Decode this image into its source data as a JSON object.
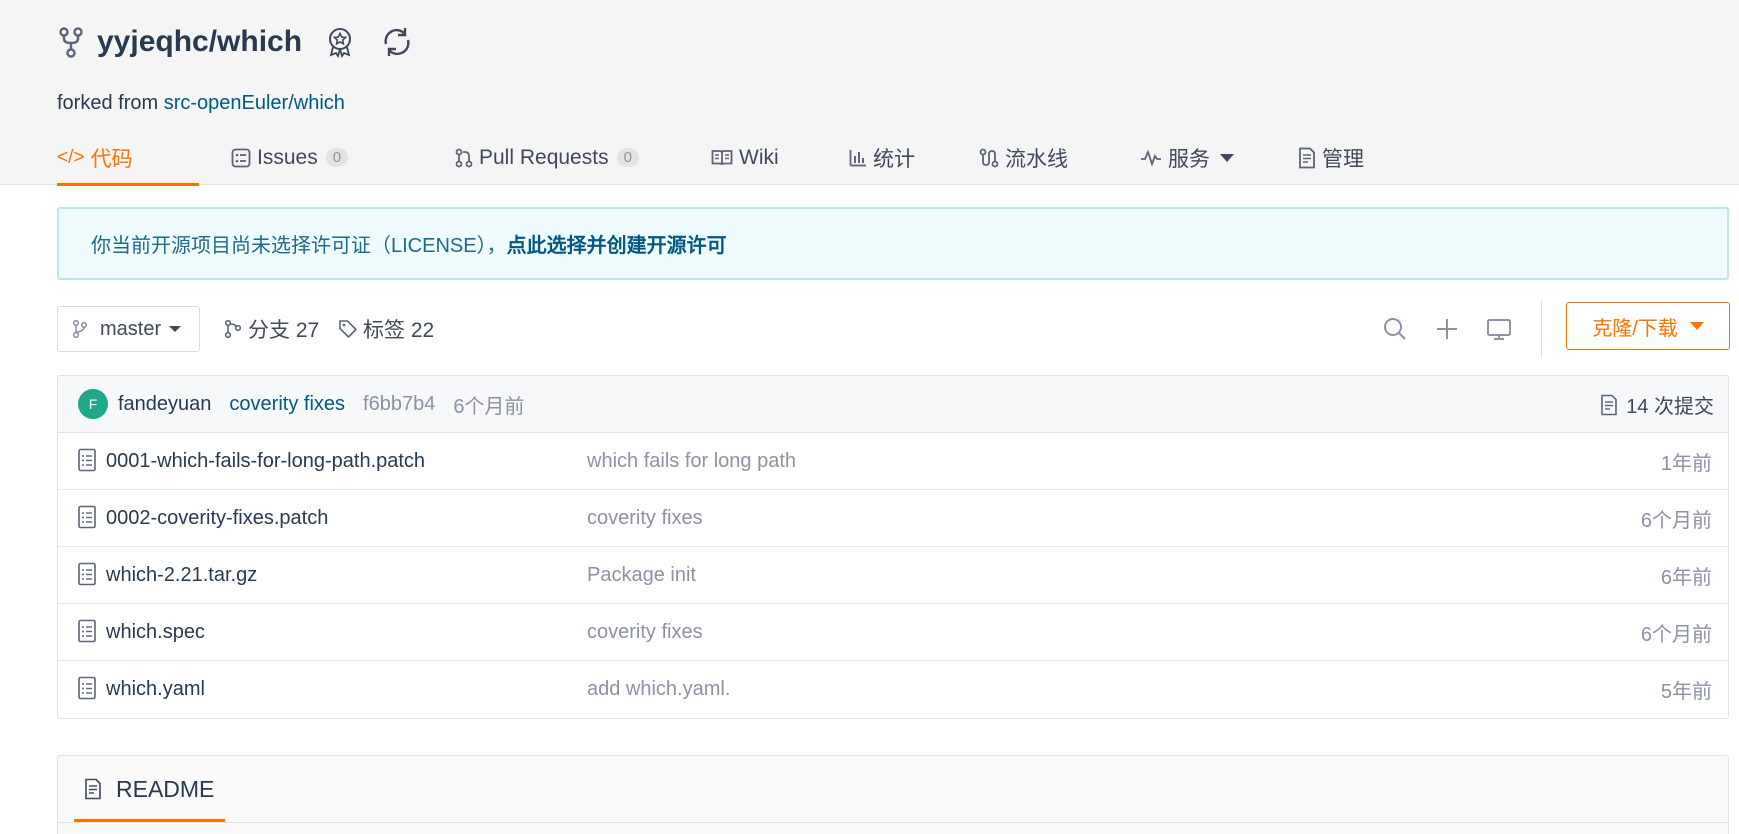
{
  "repo": {
    "full_name": "yyjeqhc/which",
    "forked_prefix": "forked from ",
    "forked_source": "src-openEuler/which"
  },
  "tabs": [
    {
      "label": "代码",
      "icon": "code-icon",
      "active": true
    },
    {
      "label": "Issues",
      "icon": "issues-icon",
      "count": "0"
    },
    {
      "label": "Pull Requests",
      "icon": "pull-request-icon",
      "count": "0"
    },
    {
      "label": "Wiki",
      "icon": "wiki-icon"
    },
    {
      "label": "统计",
      "icon": "stats-icon"
    },
    {
      "label": "流水线",
      "icon": "pipeline-icon"
    },
    {
      "label": "服务",
      "icon": "service-icon",
      "dropdown": true
    },
    {
      "label": "管理",
      "icon": "admin-icon"
    }
  ],
  "notice": {
    "text": "你当前开源项目尚未选择许可证（LICENSE），",
    "link": "点此选择并创建开源许可"
  },
  "toolbar": {
    "branch": "master",
    "branches_label": "分支 27",
    "tags_label": "标签 22",
    "clone_label": "克隆/下载"
  },
  "commit": {
    "avatar_letter": "F",
    "author": "fandeyuan",
    "message": "coverity fixes",
    "sha": "f6bb7b4",
    "time": "6个月前",
    "count_label": "14 次提交"
  },
  "files": [
    {
      "name": "0001-which-fails-for-long-path.patch",
      "message": "which fails for long path",
      "time": "1年前"
    },
    {
      "name": "0002-coverity-fixes.patch",
      "message": "coverity fixes",
      "time": "6个月前"
    },
    {
      "name": "which-2.21.tar.gz",
      "message": "Package init",
      "time": "6年前"
    },
    {
      "name": "which.spec",
      "message": "coverity fixes",
      "time": "6个月前"
    },
    {
      "name": "which.yaml",
      "message": "add which.yaml.",
      "time": "5年前"
    }
  ],
  "readme": {
    "label": "README"
  },
  "colors": {
    "accent": "#fe7300",
    "link": "#005980",
    "avatar": "#1fa88a"
  }
}
